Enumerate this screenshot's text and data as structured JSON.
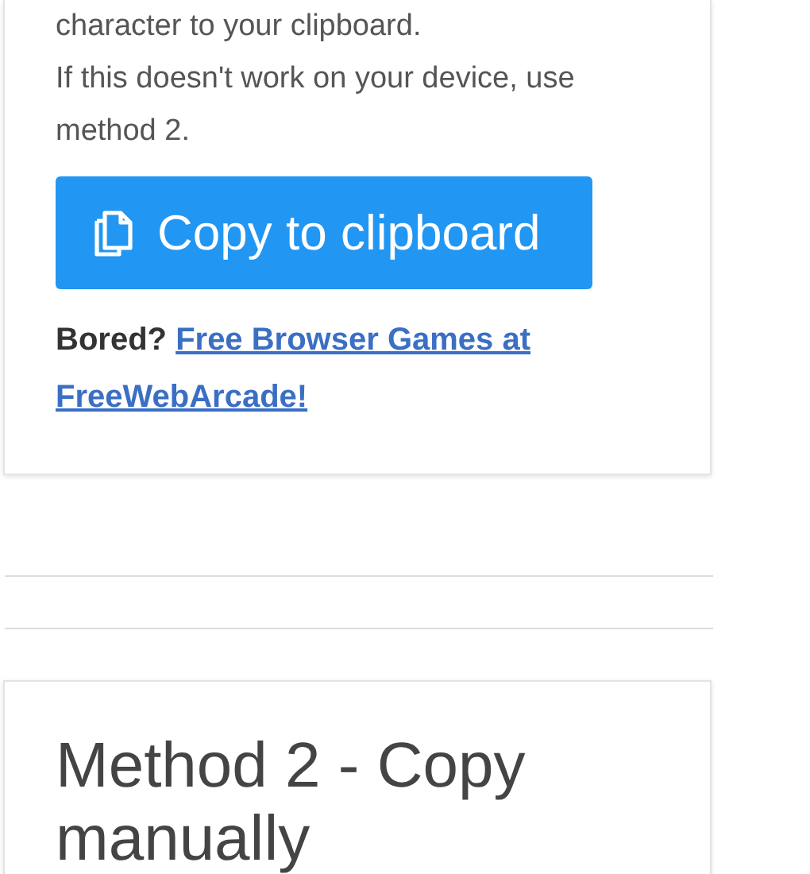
{
  "method_1": {
    "text_lines": [
      "character to your clipboard.",
      "If this doesn't work on your device, use method 2."
    ],
    "copy_button": {
      "label": "Copy to clipboard"
    },
    "promo": {
      "prefix": "Bored?",
      "link_lines": [
        "Free Browser Games at",
        "FreeWebArcade!"
      ]
    }
  },
  "method_2": {
    "title": "Method 2 - Copy manually"
  }
}
